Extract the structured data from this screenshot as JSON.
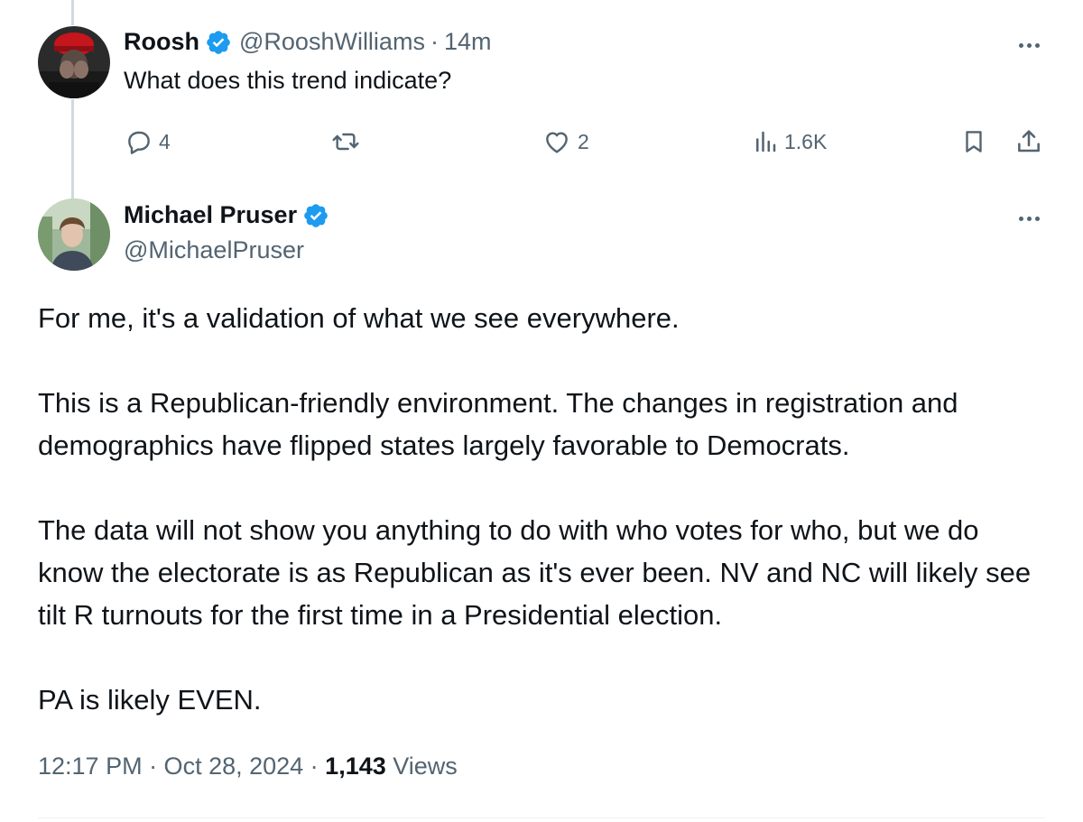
{
  "parent_tweet": {
    "display_name": "Roosh",
    "handle": "@RooshWilliams",
    "separator": "·",
    "time": "14m",
    "text": "What does this trend indicate?",
    "actions": {
      "replies": "4",
      "retweets": "",
      "likes": "2",
      "views": "1.6K"
    }
  },
  "main_tweet": {
    "display_name": "Michael Pruser",
    "handle": "@MichaelPruser",
    "paragraphs": [
      "For me, it's a validation of what we see everywhere.",
      "This is a Republican-friendly environment. The changes in registration and demographics have flipped states largely favorable to Democrats.",
      "The data will not show you anything to do with who votes for who, but we do know the electorate is as Republican as it's ever been.  NV and NC will likely see tilt R turnouts for the first time in a Presidential election.",
      "PA is likely EVEN."
    ],
    "timestamp": "12:17 PM · Oct 28, 2024 · ",
    "views_count": "1,143",
    "views_label": " Views"
  },
  "colors": {
    "verified": "#1d9bf0",
    "muted": "#536471",
    "text": "#0f1419",
    "thread_line": "#cfd9de"
  },
  "icons": {
    "reply": "reply-icon",
    "retweet": "retweet-icon",
    "like": "heart-icon",
    "views": "analytics-icon",
    "bookmark": "bookmark-icon",
    "share": "share-icon",
    "more": "more-icon",
    "verified": "verified-badge-icon"
  }
}
